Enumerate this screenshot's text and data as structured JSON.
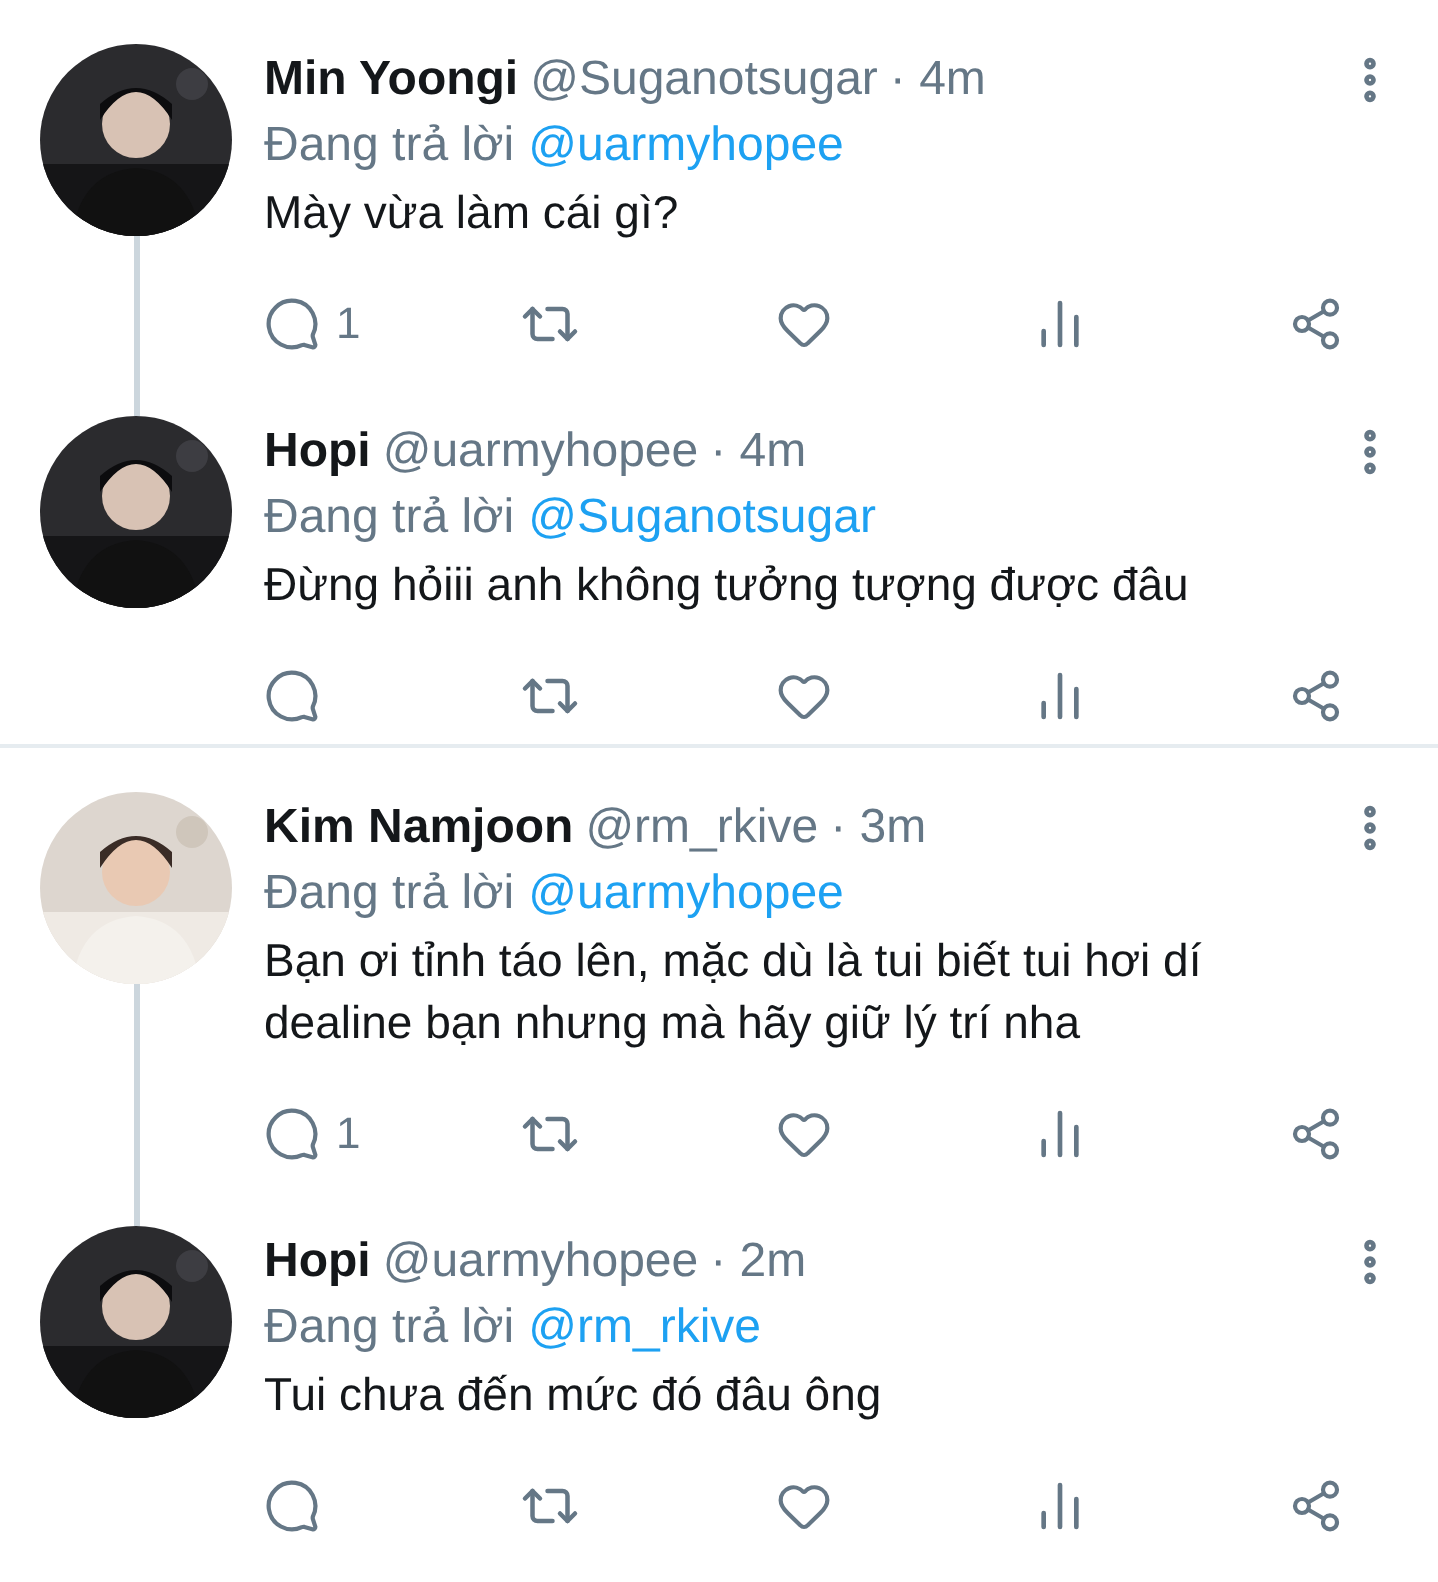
{
  "threads": [
    {
      "tweets": [
        {
          "name": "Min Yoongi",
          "handle": "@Suganotsugar",
          "time": "· 4m",
          "reply_prefix": "Đang trả lời",
          "mention": "@uarmyhopee",
          "text": "Mày vừa làm cái gì?",
          "reply_count": "1"
        },
        {
          "name": "Hopi",
          "handle": "@uarmyhopee",
          "time": "· 4m",
          "reply_prefix": "Đang trả lời",
          "mention": "@Suganotsugar",
          "text": "Đừng hỏiii anh không tưởng tượng được đâu"
        }
      ]
    },
    {
      "tweets": [
        {
          "name": "Kim Namjoon",
          "handle": "@rm_rkive",
          "time": "· 3m",
          "reply_prefix": "Đang trả lời",
          "mention": "@uarmyhopee",
          "text": "Bạn ơi tỉnh táo lên, mặc dù là tui biết tui hơi dí dealine bạn nhưng mà hãy giữ lý trí nha",
          "reply_count": "1"
        },
        {
          "name": "Hopi",
          "handle": "@uarmyhopee",
          "time": "· 2m",
          "reply_prefix": "Đang trả lời",
          "mention": "@rm_rkive",
          "text": "Tui chưa đến mức đó đâu ông"
        }
      ]
    }
  ]
}
